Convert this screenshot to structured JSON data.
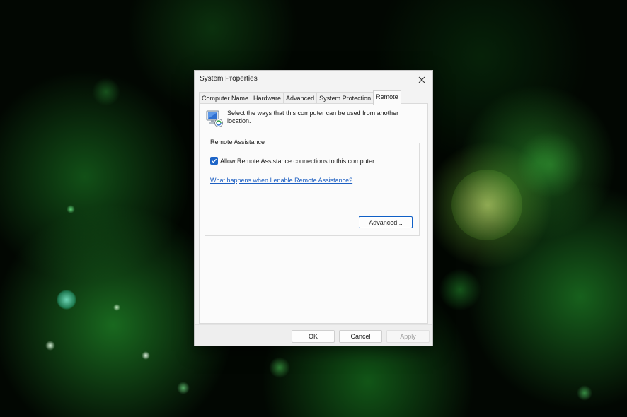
{
  "window": {
    "title": "System Properties"
  },
  "tabs": [
    {
      "label": "Computer Name",
      "active": false
    },
    {
      "label": "Hardware",
      "active": false
    },
    {
      "label": "Advanced",
      "active": false
    },
    {
      "label": "System Protection",
      "active": false
    },
    {
      "label": "Remote",
      "active": true
    }
  ],
  "remote_tab": {
    "icon": "remote-computer-icon",
    "description": "Select the ways that this computer can be used from another location.",
    "remote_assistance": {
      "group_title": "Remote Assistance",
      "allow_checkbox_label": "Allow Remote Assistance connections to this computer",
      "allow_checked": true,
      "help_link": "What happens when I enable Remote Assistance?",
      "advanced_button": "Advanced..."
    }
  },
  "footer": {
    "ok": "OK",
    "cancel": "Cancel",
    "apply": "Apply",
    "apply_enabled": false
  },
  "colors": {
    "accent": "#1e65c7",
    "link": "#1d5fc2",
    "window_bg": "#f3f3f3",
    "wallpaper_dark": "#020702",
    "wallpaper_green": "#2eaa3a"
  }
}
